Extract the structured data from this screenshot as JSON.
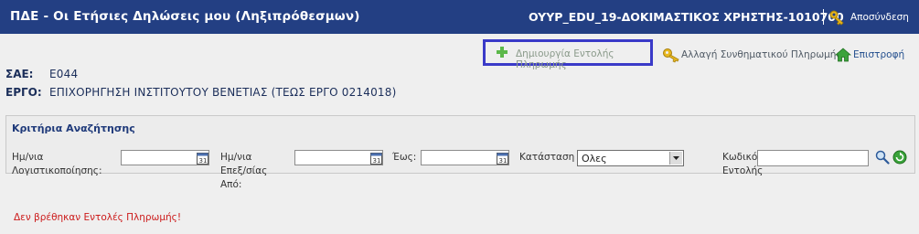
{
  "header": {
    "title": "ΠΔΕ - Οι Ετήσιες Δηλώσεις μου (Ληξιπρόθεσμων)",
    "user": "OYYP_EDU_19-ΔΟΚΙΜΑΣΤΙΚΟΣ ΧΡΗΣΤΗΣ-1010700",
    "logout_label": "Αποσύνδεση"
  },
  "actions": {
    "create_label": "Δημιουργία Εντολής Πληρωμής",
    "change_code_label": "Αλλαγή Συνθηματικού Πληρωμής",
    "back_label": "Επιστροφή"
  },
  "info": {
    "sae_label": "ΣΑΕ:",
    "sae_value": "Ε044",
    "ergo_label": "ΕΡΓΟ:",
    "ergo_value": "ΕΠΙΧΟΡΗΓΗΣΗ ΙΝΣΤΙΤΟΥΤΟΥ ΒΕΝΕΤΙΑΣ (ΤΕΩΣ ΕΡΓΟ 0214018)"
  },
  "search": {
    "title": "Κριτήρια Αναζήτησης",
    "accounting_date_label_1": "Ημ/νια",
    "accounting_date_label_2": "Λογιστικοποίησης:",
    "processing_date_label_1": "Ημ/νια",
    "processing_date_label_2": "Επεξ/σίας",
    "processing_date_label_3": "Από:",
    "to_label": "Έως:",
    "status_label": "Κατάσταση",
    "status_value": "Ολες",
    "code_label_1": "Κωδικός",
    "code_label_2": "Εντολής",
    "accounting_date_value": "",
    "from_date_value": "",
    "to_date_value": "",
    "code_value": ""
  },
  "message": "Δεν βρέθηκαν Εντολές Πληρωμής!"
}
